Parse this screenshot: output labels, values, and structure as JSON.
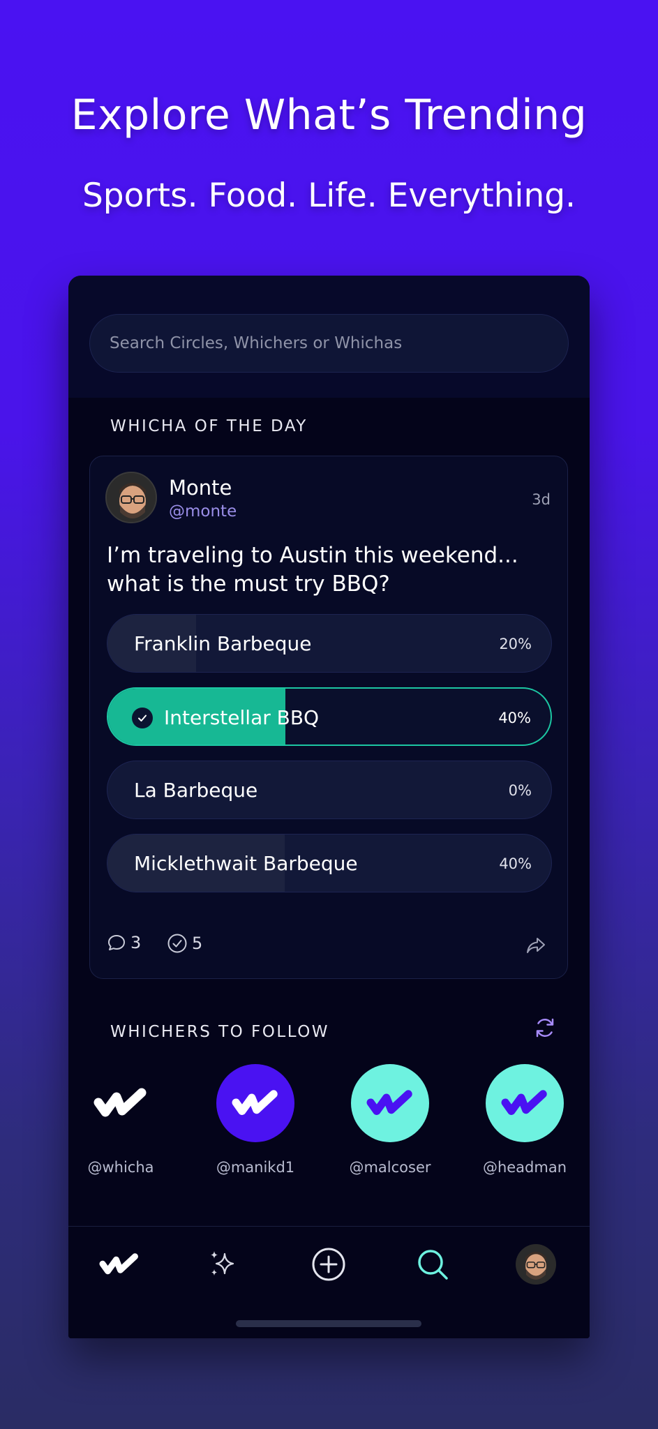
{
  "hero": {
    "title": "Explore What’s Trending",
    "subtitle": "Sports. Food. Life. Everything."
  },
  "search": {
    "placeholder": "Search Circles, Whichers or Whichas"
  },
  "whicha_of_the_day": {
    "section_title": "WHICHA OF THE DAY",
    "author": {
      "name": "Monte",
      "handle": "@monte"
    },
    "time_ago": "3d",
    "question": "I’m traveling to Austin this weekend... what is the must try BBQ?",
    "options": [
      {
        "label": "Franklin Barbeque",
        "percent": "20%",
        "share": 0.2,
        "selected": false
      },
      {
        "label": "Interstellar BBQ",
        "percent": "40%",
        "share": 0.4,
        "selected": true
      },
      {
        "label": "La Barbeque",
        "percent": "0%",
        "share": 0.0,
        "selected": false
      },
      {
        "label": "Micklethwait Barbeque",
        "percent": "40%",
        "share": 0.4,
        "selected": false
      }
    ],
    "comments_count": "3",
    "votes_count": "5"
  },
  "whichers_to_follow": {
    "section_title": "WHICHERS TO FOLLOW",
    "users": [
      {
        "handle": "@whicha",
        "style": "white-logo"
      },
      {
        "handle": "@manikd1",
        "style": "purple-circle"
      },
      {
        "handle": "@malcoser",
        "style": "mint-circle"
      },
      {
        "handle": "@headman",
        "style": "mint-circle"
      }
    ]
  },
  "tabbar": {
    "items": [
      "home-icon",
      "sparkles-icon",
      "plus-circle-icon",
      "search-icon",
      "profile-avatar"
    ],
    "active": "search-icon"
  },
  "colors": {
    "brand_purple": "#4a12f2",
    "accent_teal": "#17b894",
    "mint": "#6ef2e0",
    "handle_purple": "#9a8ee8"
  }
}
